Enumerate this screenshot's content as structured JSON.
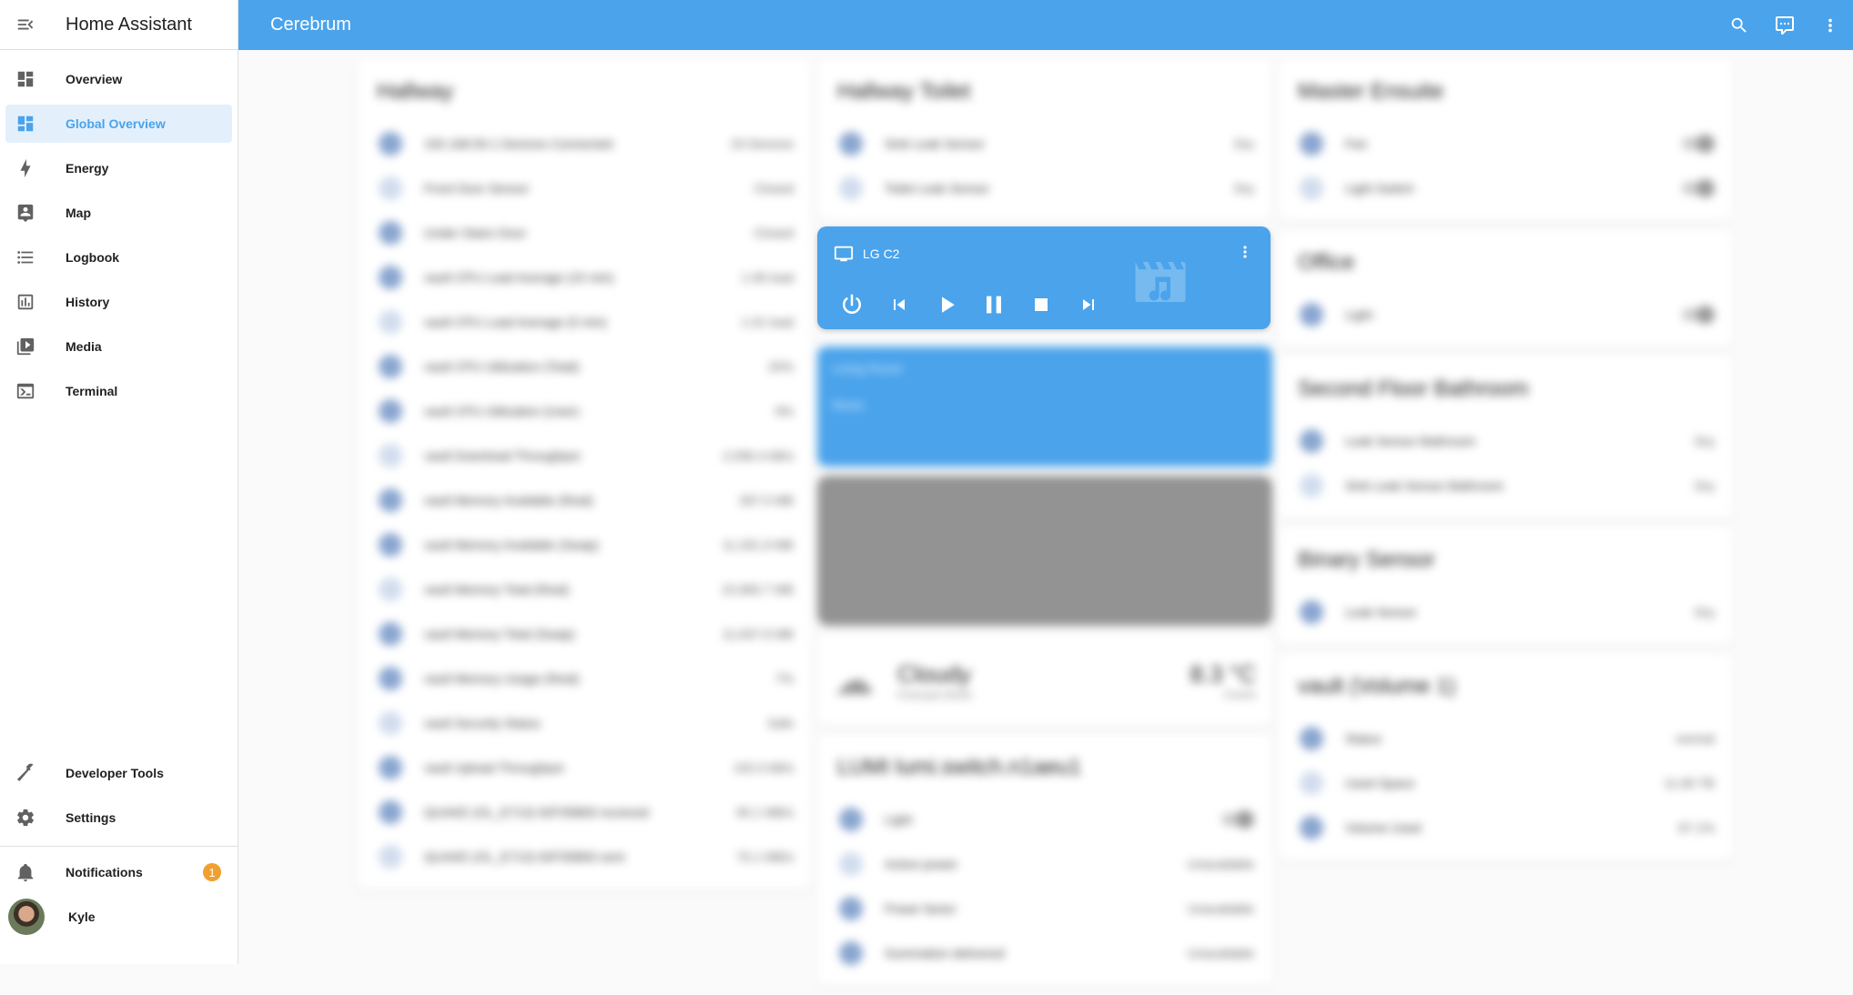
{
  "sidebar": {
    "title": "Home Assistant",
    "items": [
      {
        "label": "Overview",
        "icon": "view-dashboard-icon",
        "active": false
      },
      {
        "label": "Global Overview",
        "icon": "view-dashboard-icon",
        "active": true
      },
      {
        "label": "Energy",
        "icon": "lightning-bolt-icon",
        "active": false
      },
      {
        "label": "Map",
        "icon": "map-account-icon",
        "active": false
      },
      {
        "label": "Logbook",
        "icon": "format-list-icon",
        "active": false
      },
      {
        "label": "History",
        "icon": "chart-box-icon",
        "active": false
      },
      {
        "label": "Media",
        "icon": "play-box-multiple-icon",
        "active": false
      },
      {
        "label": "Terminal",
        "icon": "console-icon",
        "active": false
      }
    ],
    "bottom": {
      "developer_tools": "Developer Tools",
      "settings": "Settings",
      "notifications": "Notifications",
      "notifications_count": "1",
      "user": "Kyle"
    }
  },
  "topbar": {
    "title": "Cerebrum",
    "accent": "#4aa3eb"
  },
  "background": {
    "col1": {
      "title": "Hallway",
      "rows": [
        {
          "name": "192.168.50.1 Devices Connected",
          "value": "23 Devices"
        },
        {
          "name": "Front Door Sensor",
          "value": "Closed"
        },
        {
          "name": "Under Stairs Door",
          "value": "Closed"
        },
        {
          "name": "vault CPU Load Average (15 min)",
          "value": "1.06 load"
        },
        {
          "name": "vault CPU Load Average (5 min)",
          "value": "1.01 load"
        },
        {
          "name": "vault CPU Utilization (Total)",
          "value": "20%"
        },
        {
          "name": "vault CPU Utilization (User)",
          "value": "9%"
        },
        {
          "name": "vault Download Throughput",
          "value": "2,056.4 kB/s"
        },
        {
          "name": "vault Memory Available (Real)",
          "value": "267.0 MB"
        },
        {
          "name": "vault Memory Available (Swap)",
          "value": "11,331.9 MB"
        },
        {
          "name": "vault Memory Total (Real)",
          "value": "15,983.7 MB"
        },
        {
          "name": "vault Memory Total (Swap)",
          "value": "11,637.6 MB"
        },
        {
          "name": "vault Memory Usage (Real)",
          "value": "7%"
        },
        {
          "name": "vault Security Status",
          "value": "Safe"
        },
        {
          "name": "vault Upload Throughput",
          "value": "102.0 kB/s"
        },
        {
          "name": "QUAKE (OL_E713) 92F35B83 received",
          "value": "90.1 MB/s"
        },
        {
          "name": "QUAKE (OL_E713) 92F35B83 sent",
          "value": "70.1 MB/s"
        }
      ]
    },
    "col2": {
      "title": "Hallway Toilet",
      "rows": [
        {
          "name": "Sink Leak Sensor",
          "value": "Dry"
        },
        {
          "name": "Toilet Leak Sensor",
          "value": "Dry"
        }
      ],
      "media2": {
        "name": "Living Room",
        "state": "Music"
      },
      "weather": {
        "condition": "Cloudy",
        "location": "Forecast Home",
        "temperature": "8.3 °C",
        "wind": "3 km/h"
      },
      "lumi": {
        "title": "LUMI lumi.switch.n1aeu1",
        "rows": [
          {
            "name": "Light",
            "value": ""
          },
          {
            "name": "Active power",
            "value": "Unavailable"
          },
          {
            "name": "Power factor",
            "value": "Unavailable"
          },
          {
            "name": "Summation delivered",
            "value": "Unavailable"
          }
        ]
      }
    },
    "col3": {
      "cards": [
        {
          "title": "Master Ensuite",
          "rows": [
            {
              "name": "Fan",
              "value": ""
            },
            {
              "name": "Light Switch",
              "value": ""
            }
          ],
          "has_toggle": true
        },
        {
          "title": "Office",
          "rows": [
            {
              "name": "Light",
              "value": ""
            }
          ],
          "has_toggle": true
        },
        {
          "title": "Second Floor Bathroom",
          "rows": [
            {
              "name": "Leak Sensor Bathroom",
              "value": "Dry"
            },
            {
              "name": "Sink Leak Sensor Bathroom",
              "value": "Dry"
            }
          ]
        },
        {
          "title": "Binary Sensor",
          "rows": [
            {
              "name": "Leak Sensor",
              "value": "Dry"
            }
          ]
        },
        {
          "title": "vault (Volume 1)",
          "rows": [
            {
              "name": "Status",
              "value": "normal"
            },
            {
              "name": "Used Space",
              "value": "11.65 TB"
            },
            {
              "name": "Volume Used",
              "value": "67.1%"
            }
          ]
        }
      ]
    }
  },
  "media_player": {
    "name": "LG C2",
    "device_icon": "television-icon",
    "controls": [
      "power",
      "previous",
      "play",
      "pause",
      "stop",
      "next"
    ]
  }
}
